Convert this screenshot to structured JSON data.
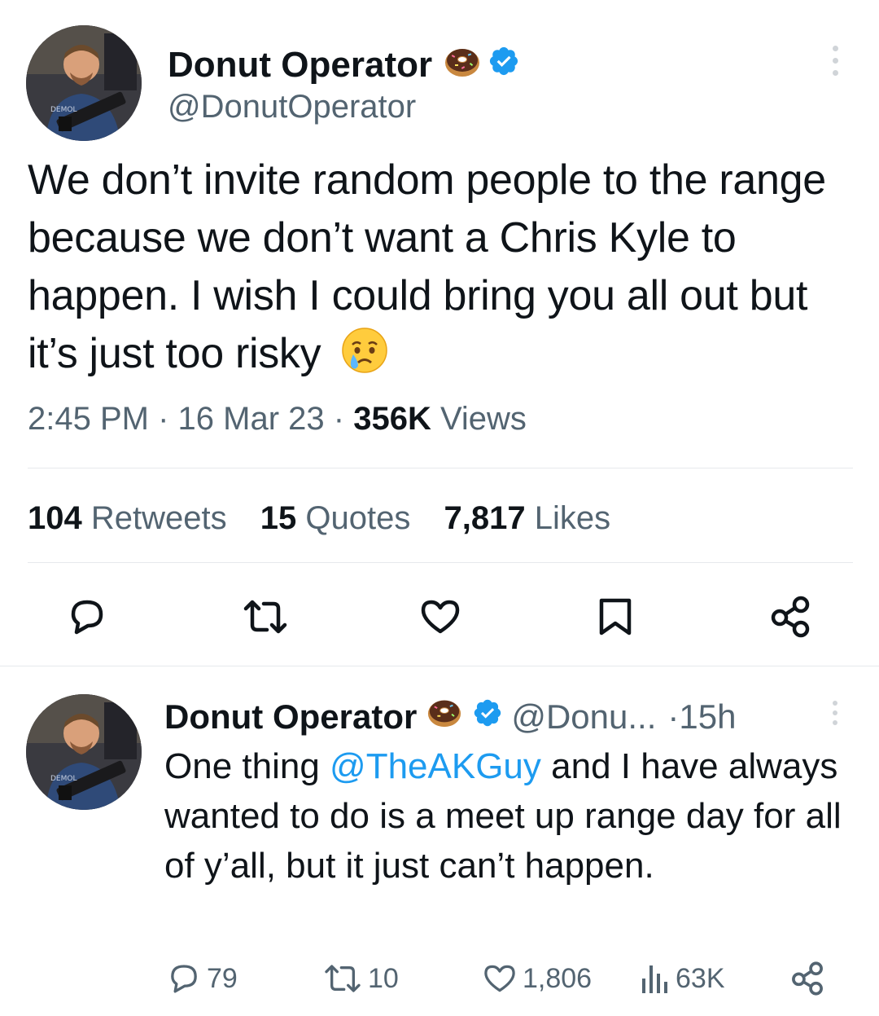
{
  "colors": {
    "text": "#0f1419",
    "secondary": "#536471",
    "accent": "#1d9bf0",
    "divider": "#e6e9ec"
  },
  "main_tweet": {
    "author_name": "Donut Operator",
    "author_handle": "@DonutOperator",
    "badge_icons": [
      "donut-emoji-icon",
      "verified-badge-icon"
    ],
    "text": "We don’t invite random people to the range because we don’t want a Chris Kyle to happen. I wish I could bring you all out but it’s just too risky",
    "text_emoji": "crying-face-emoji-icon",
    "time": "2:45 PM",
    "date": "16 Mar 23",
    "views_count": "356K",
    "views_label": "Views",
    "stats": {
      "retweets_count": "104",
      "retweets_label": "Retweets",
      "quotes_count": "15",
      "quotes_label": "Quotes",
      "likes_count": "7,817",
      "likes_label": "Likes"
    },
    "actions": [
      "reply-icon",
      "retweet-icon",
      "like-icon",
      "bookmark-icon",
      "share-icon"
    ]
  },
  "reply_tweet": {
    "author_name": "Donut Operator",
    "author_handle": "@Donu...",
    "time": "15h",
    "separator": "·",
    "text_before_mention": "One thing ",
    "mention": "@TheAKGuy",
    "text_after_mention": " and I have always wanted to do is a meet up range day for all of y’all, but it just can’t happen.",
    "counts": {
      "replies": "79",
      "retweets": "10",
      "likes": "1,806",
      "views": "63K"
    }
  }
}
